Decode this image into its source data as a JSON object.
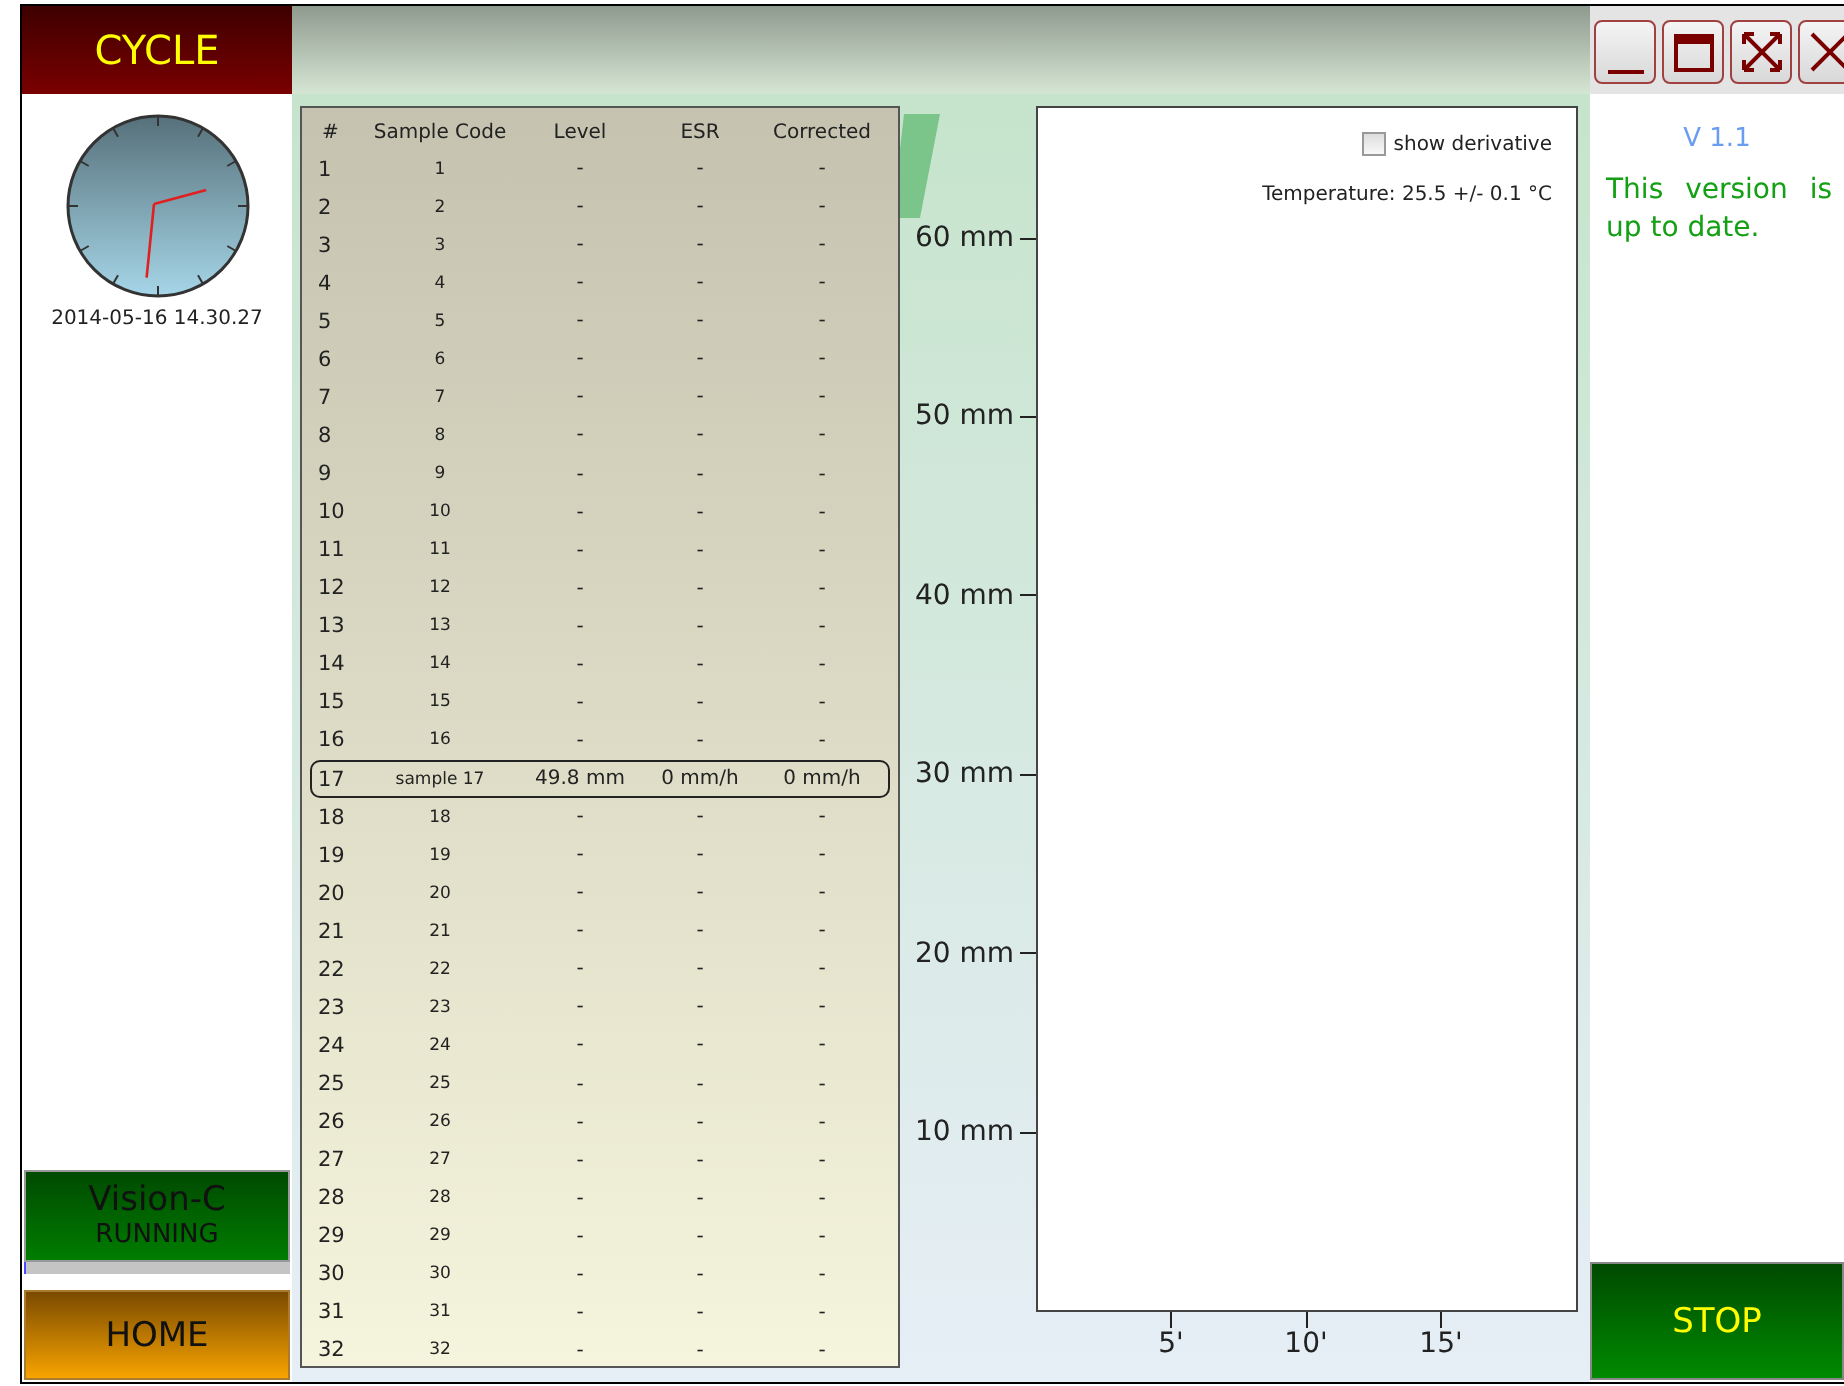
{
  "sidebar": {
    "mode_button": "CYCLE",
    "datetime": "2014-05-16 14.30.27",
    "instrument": {
      "name": "Vision-C",
      "status": "RUNNING",
      "level": 0.01
    },
    "home_button": "HOME"
  },
  "table": {
    "columns": [
      "#",
      "Sample Code",
      "Level",
      "ESR",
      "Corrected"
    ],
    "rows": [
      {
        "cells": [
          "1",
          "1",
          "-",
          "-",
          "-"
        ],
        "selected": false
      },
      {
        "cells": [
          "2",
          "2",
          "-",
          "-",
          "-"
        ],
        "selected": false
      },
      {
        "cells": [
          "3",
          "3",
          "-",
          "-",
          "-"
        ],
        "selected": false
      },
      {
        "cells": [
          "4",
          "4",
          "-",
          "-",
          "-"
        ],
        "selected": false
      },
      {
        "cells": [
          "5",
          "5",
          "-",
          "-",
          "-"
        ],
        "selected": false
      },
      {
        "cells": [
          "6",
          "6",
          "-",
          "-",
          "-"
        ],
        "selected": false
      },
      {
        "cells": [
          "7",
          "7",
          "-",
          "-",
          "-"
        ],
        "selected": false
      },
      {
        "cells": [
          "8",
          "8",
          "-",
          "-",
          "-"
        ],
        "selected": false
      },
      {
        "cells": [
          "9",
          "9",
          "-",
          "-",
          "-"
        ],
        "selected": false
      },
      {
        "cells": [
          "10",
          "10",
          "-",
          "-",
          "-"
        ],
        "selected": false
      },
      {
        "cells": [
          "11",
          "11",
          "-",
          "-",
          "-"
        ],
        "selected": false
      },
      {
        "cells": [
          "12",
          "12",
          "-",
          "-",
          "-"
        ],
        "selected": false
      },
      {
        "cells": [
          "13",
          "13",
          "-",
          "-",
          "-"
        ],
        "selected": false
      },
      {
        "cells": [
          "14",
          "14",
          "-",
          "-",
          "-"
        ],
        "selected": false
      },
      {
        "cells": [
          "15",
          "15",
          "-",
          "-",
          "-"
        ],
        "selected": false
      },
      {
        "cells": [
          "16",
          "16",
          "-",
          "-",
          "-"
        ],
        "selected": false
      },
      {
        "cells": [
          "17",
          "sample 17",
          "49.8 mm",
          "0 mm/h",
          "0 mm/h"
        ],
        "selected": true
      },
      {
        "cells": [
          "18",
          "18",
          "-",
          "-",
          "-"
        ],
        "selected": false
      },
      {
        "cells": [
          "19",
          "19",
          "-",
          "-",
          "-"
        ],
        "selected": false
      },
      {
        "cells": [
          "20",
          "20",
          "-",
          "-",
          "-"
        ],
        "selected": false
      },
      {
        "cells": [
          "21",
          "21",
          "-",
          "-",
          "-"
        ],
        "selected": false
      },
      {
        "cells": [
          "22",
          "22",
          "-",
          "-",
          "-"
        ],
        "selected": false
      },
      {
        "cells": [
          "23",
          "23",
          "-",
          "-",
          "-"
        ],
        "selected": false
      },
      {
        "cells": [
          "24",
          "24",
          "-",
          "-",
          "-"
        ],
        "selected": false
      },
      {
        "cells": [
          "25",
          "25",
          "-",
          "-",
          "-"
        ],
        "selected": false
      },
      {
        "cells": [
          "26",
          "26",
          "-",
          "-",
          "-"
        ],
        "selected": false
      },
      {
        "cells": [
          "27",
          "27",
          "-",
          "-",
          "-"
        ],
        "selected": false
      },
      {
        "cells": [
          "28",
          "28",
          "-",
          "-",
          "-"
        ],
        "selected": false
      },
      {
        "cells": [
          "29",
          "29",
          "-",
          "-",
          "-"
        ],
        "selected": false
      },
      {
        "cells": [
          "30",
          "30",
          "-",
          "-",
          "-"
        ],
        "selected": false
      },
      {
        "cells": [
          "31",
          "31",
          "-",
          "-",
          "-"
        ],
        "selected": false
      },
      {
        "cells": [
          "32",
          "32",
          "-",
          "-",
          "-"
        ],
        "selected": false
      }
    ]
  },
  "plot": {
    "show_derivative": {
      "label": "show derivative",
      "checked": false
    },
    "temperature": "Temperature: 25.5 +/- 0.1 °C",
    "y_ticks": [
      "60 mm",
      "50 mm",
      "40 mm",
      "30 mm",
      "20 mm",
      "10 mm"
    ],
    "x_ticks": [
      "5'",
      "10'",
      "15'"
    ]
  },
  "right_panel": {
    "window_buttons": [
      {
        "kind": "minimize"
      },
      {
        "kind": "restore"
      },
      {
        "kind": "fullscreen"
      },
      {
        "kind": "close"
      }
    ],
    "version": "V 1.1",
    "update_message": "This version is up to date.",
    "stop_button": "STOP"
  }
}
